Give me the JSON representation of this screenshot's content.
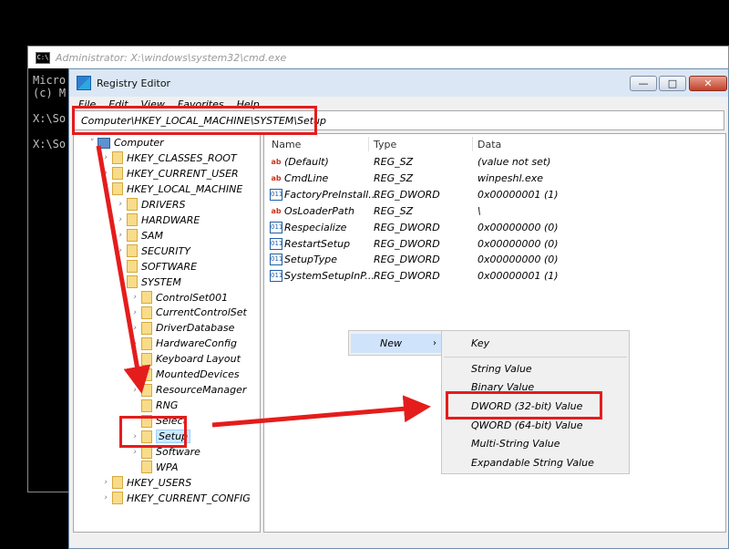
{
  "cmd": {
    "title": "Administrator: X:\\windows\\system32\\cmd.exe",
    "icon_label": "C:\\",
    "lines": [
      "Micro",
      "(c) M",
      "",
      "X:\\So",
      "",
      "X:\\So"
    ]
  },
  "regedit": {
    "title": "Registry Editor",
    "menu": [
      "File",
      "Edit",
      "View",
      "Favorites",
      "Help"
    ],
    "window_buttons": {
      "minimize": "—",
      "maximize": "□",
      "close": "✕"
    },
    "address": "Computer\\HKEY_LOCAL_MACHINE\\SYSTEM\\Setup",
    "tree": [
      {
        "label": "Computer",
        "level": 0,
        "exp": "˅",
        "icon": "computer-icon"
      },
      {
        "label": "HKEY_CLASSES_ROOT",
        "level": 1,
        "exp": "›",
        "icon": "folder-icon"
      },
      {
        "label": "HKEY_CURRENT_USER",
        "level": 1,
        "exp": "›",
        "icon": "folder-icon"
      },
      {
        "label": "HKEY_LOCAL_MACHINE",
        "level": 1,
        "exp": "˅",
        "icon": "folder-icon"
      },
      {
        "label": "DRIVERS",
        "level": 2,
        "exp": "›",
        "icon": "folder-icon"
      },
      {
        "label": "HARDWARE",
        "level": 2,
        "exp": "›",
        "icon": "folder-icon"
      },
      {
        "label": "SAM",
        "level": 2,
        "exp": "›",
        "icon": "folder-icon"
      },
      {
        "label": "SECURITY",
        "level": 2,
        "exp": "›",
        "icon": "folder-icon"
      },
      {
        "label": "SOFTWARE",
        "level": 2,
        "exp": "›",
        "icon": "folder-icon"
      },
      {
        "label": "SYSTEM",
        "level": 2,
        "exp": "˅",
        "icon": "folder-icon"
      },
      {
        "label": "ControlSet001",
        "level": 3,
        "exp": "›",
        "icon": "folder-icon"
      },
      {
        "label": "CurrentControlSet",
        "level": 3,
        "exp": "›",
        "icon": "folder-icon"
      },
      {
        "label": "DriverDatabase",
        "level": 3,
        "exp": "›",
        "icon": "folder-icon"
      },
      {
        "label": "HardwareConfig",
        "level": 3,
        "exp": "›",
        "icon": "folder-icon"
      },
      {
        "label": "Keyboard Layout",
        "level": 3,
        "exp": "›",
        "icon": "folder-icon"
      },
      {
        "label": "MountedDevices",
        "level": 3,
        "exp": "",
        "icon": "folder-icon"
      },
      {
        "label": "ResourceManager",
        "level": 3,
        "exp": "›",
        "icon": "folder-icon"
      },
      {
        "label": "RNG",
        "level": 3,
        "exp": "",
        "icon": "folder-icon"
      },
      {
        "label": "Select",
        "level": 3,
        "exp": "",
        "icon": "folder-icon"
      },
      {
        "label": "Setup",
        "level": 3,
        "exp": "›",
        "icon": "folder-icon",
        "selected": true
      },
      {
        "label": "Software",
        "level": 3,
        "exp": "›",
        "icon": "folder-icon"
      },
      {
        "label": "WPA",
        "level": 3,
        "exp": "",
        "icon": "folder-icon"
      },
      {
        "label": "HKEY_USERS",
        "level": 1,
        "exp": "›",
        "icon": "folder-icon"
      },
      {
        "label": "HKEY_CURRENT_CONFIG",
        "level": 1,
        "exp": "›",
        "icon": "folder-icon"
      }
    ],
    "columns": {
      "name": "Name",
      "type": "Type",
      "data": "Data"
    },
    "values": [
      {
        "name": "(Default)",
        "type": "REG_SZ",
        "data": "(value not set)",
        "icon": "string-value-icon",
        "icon_text": "ab"
      },
      {
        "name": "CmdLine",
        "type": "REG_SZ",
        "data": "winpeshl.exe",
        "icon": "string-value-icon",
        "icon_text": "ab"
      },
      {
        "name": "FactoryPreInstall...",
        "type": "REG_DWORD",
        "data": "0x00000001 (1)",
        "icon": "dword-value-icon",
        "icon_text": "011"
      },
      {
        "name": "OsLoaderPath",
        "type": "REG_SZ",
        "data": "\\",
        "icon": "string-value-icon",
        "icon_text": "ab"
      },
      {
        "name": "Respecialize",
        "type": "REG_DWORD",
        "data": "0x00000000 (0)",
        "icon": "dword-value-icon",
        "icon_text": "011"
      },
      {
        "name": "RestartSetup",
        "type": "REG_DWORD",
        "data": "0x00000000 (0)",
        "icon": "dword-value-icon",
        "icon_text": "011"
      },
      {
        "name": "SetupType",
        "type": "REG_DWORD",
        "data": "0x00000000 (0)",
        "icon": "dword-value-icon",
        "icon_text": "011"
      },
      {
        "name": "SystemSetupInP...",
        "type": "REG_DWORD",
        "data": "0x00000001 (1)",
        "icon": "dword-value-icon",
        "icon_text": "011"
      }
    ],
    "context_menu": {
      "new_label": "New",
      "submenu": [
        "Key",
        "String Value",
        "Binary Value",
        "DWORD (32-bit) Value",
        "QWORD (64-bit) Value",
        "Multi-String Value",
        "Expandable String Value"
      ]
    }
  },
  "annotations": {
    "highlight_color": "#e51c1c"
  }
}
